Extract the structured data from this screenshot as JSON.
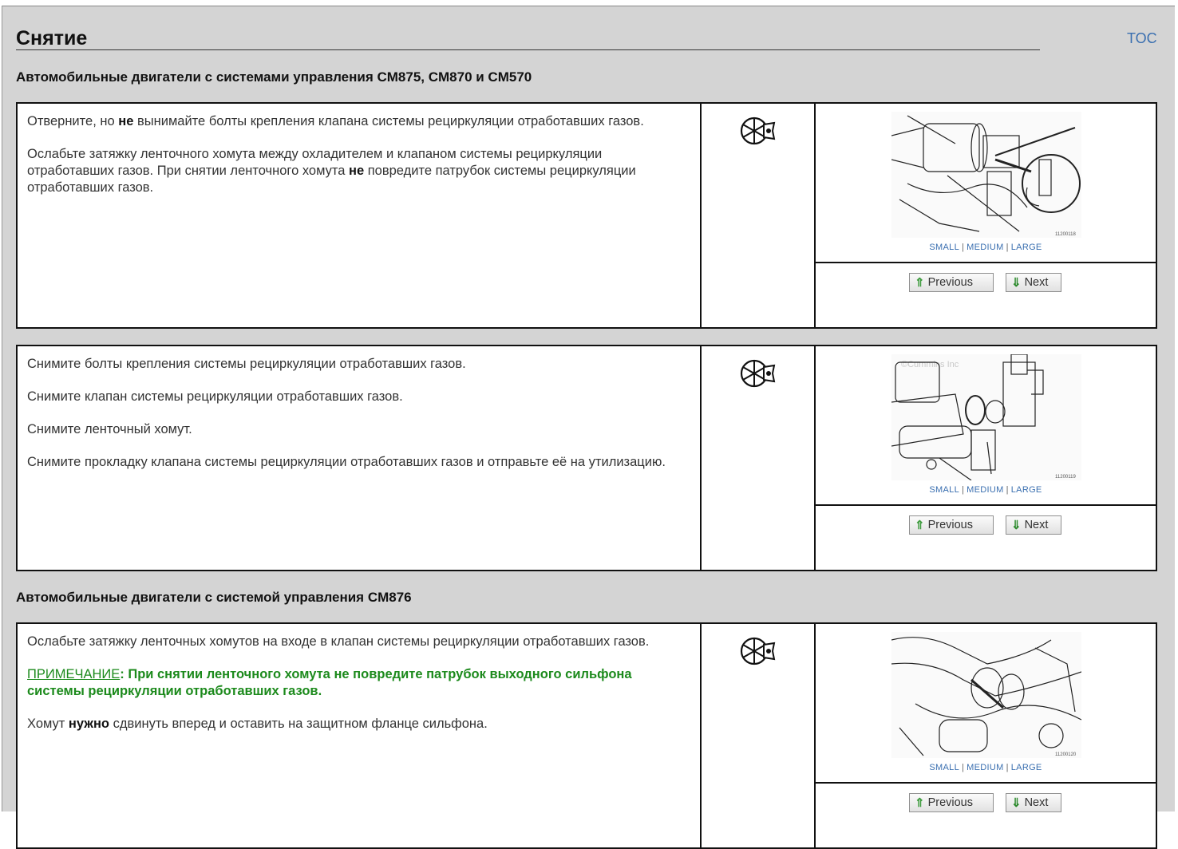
{
  "page": {
    "title": "Снятие",
    "toc_label": "TOC"
  },
  "sections": [
    {
      "heading": "Автомобильные двигатели с системами управления CM875, CM870 и CM570",
      "steps": [
        {
          "paragraphs": [
            {
              "pre": "Отверните, но ",
              "bold": "не",
              "post": " вынимайте болты крепления клапана системы рециркуляции отработавших газов."
            },
            {
              "pre": "Ослабьте затяжку ленточного хомута между охладителем и клапаном системы рециркуляции отработавших газов. При снятии ленточного хомута ",
              "bold": "не",
              "post": " повредите патрубок системы рециркуляции отработавших газов."
            }
          ],
          "tool_icon": "wrench-tool-icon",
          "image_id": "11200118"
        },
        {
          "paragraphs": [
            {
              "text": "Снимите болты крепления системы рециркуляции отработавших газов."
            },
            {
              "text": "Снимите клапан системы рециркуляции отработавших газов."
            },
            {
              "text": "Снимите ленточный хомут."
            },
            {
              "text": "Снимите прокладку клапана системы рециркуляции отработавших газов и отправьте её на утилизацию."
            }
          ],
          "tool_icon": "wrench-tool-icon",
          "image_id": "11200119",
          "watermark": "©Cummins Inc"
        }
      ]
    },
    {
      "heading": "Автомобильные двигатели с системой управления CM876",
      "steps": [
        {
          "paragraphs": [
            {
              "text": "Ослабьте затяжку ленточных хомутов на входе в клапан системы рециркуляции отработавших газов."
            },
            {
              "note_label": "ПРИМЕЧАНИЕ",
              "note_text": ": При снятии ленточного хомута не повредите патрубок выходного сильфона системы рециркуляции отработавших газов."
            },
            {
              "pre": "Хомут ",
              "bold": "нужно",
              "post": " сдвинуть вперед и оставить на защитном фланце сильфона."
            }
          ],
          "tool_icon": "wrench-tool-icon",
          "image_id": "11200120"
        }
      ]
    }
  ],
  "image_size_links": {
    "small": "SMALL",
    "medium": "MEDIUM",
    "large": "LARGE",
    "separator": "|"
  },
  "nav_buttons": {
    "previous": "Previous",
    "next": "Next",
    "previous_icon": "up-arrow-icon",
    "next_icon": "down-arrow-icon"
  },
  "colors": {
    "background": "#d4d4d4",
    "link": "#3a6fb0",
    "note_green": "#1c8a1c",
    "border": "#111111"
  }
}
